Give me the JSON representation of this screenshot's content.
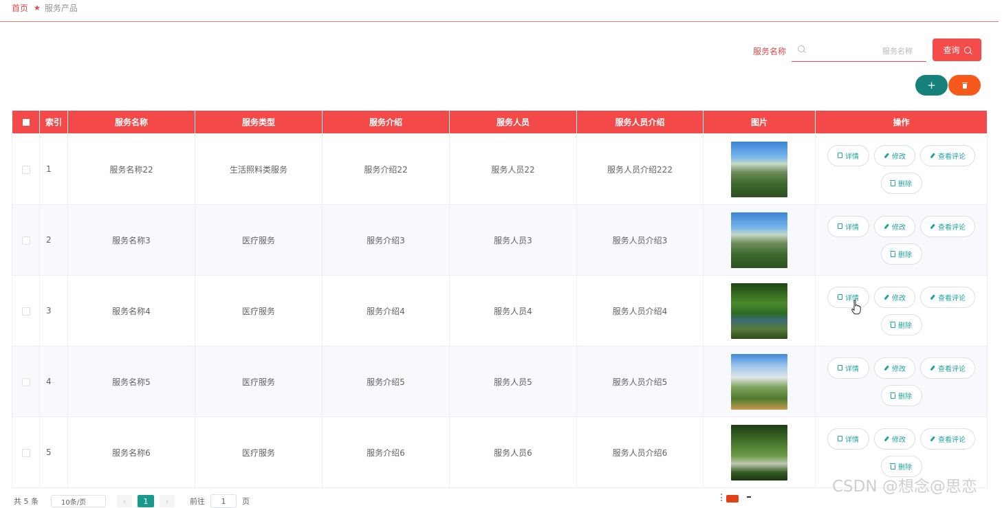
{
  "breadcrumb": {
    "home": "首页",
    "current": "服务产品"
  },
  "search": {
    "label": "服务名称",
    "placeholder": "服务名称",
    "value": "",
    "button": "查询"
  },
  "actions": {
    "add_glyph": "+"
  },
  "table": {
    "columns": [
      "索引",
      "服务名称",
      "服务类型",
      "服务介绍",
      "服务人员",
      "服务人员介绍",
      "图片",
      "操作"
    ],
    "rows": [
      {
        "index": "1",
        "name": "服务名称22",
        "type": "生活照料类服务",
        "intro": "服务介绍22",
        "staff": "服务人员22",
        "staff_intro": "服务人员介绍222",
        "image": "city-park"
      },
      {
        "index": "2",
        "name": "服务名称3",
        "type": "医疗服务",
        "intro": "服务介绍3",
        "staff": "服务人员3",
        "staff_intro": "服务人员介绍3",
        "image": "city-park"
      },
      {
        "index": "3",
        "name": "服务名称4",
        "type": "医疗服务",
        "intro": "服务介绍4",
        "staff": "服务人员4",
        "staff_intro": "服务人员介绍4",
        "image": "river-garden"
      },
      {
        "index": "4",
        "name": "服务名称5",
        "type": "医疗服务",
        "intro": "服务介绍5",
        "staff": "服务人员5",
        "staff_intro": "服务人员介绍5",
        "image": "tower-garden"
      },
      {
        "index": "5",
        "name": "服务名称6",
        "type": "医疗服务",
        "intro": "服务介绍6",
        "staff": "服务人员6",
        "staff_intro": "服务人员介绍6",
        "image": "garden-path"
      }
    ],
    "row_actions": {
      "detail": "详情",
      "edit": "修改",
      "comments": "查看评论",
      "delete": "删除"
    }
  },
  "pagination": {
    "total": "共 5 条",
    "page_size": "10条/页",
    "current_page": "1",
    "goto_label": "前往",
    "goto_value": "1",
    "page_unit": "页",
    "prev": "‹",
    "next": "›"
  },
  "watermark": "CSDN @想念@思恋",
  "colors": {
    "primary": "#f44949",
    "teal": "#16807a",
    "orange": "#f55a1a",
    "action_text": "#20a39b"
  },
  "icons": {
    "breadcrumb_separator": "★"
  }
}
